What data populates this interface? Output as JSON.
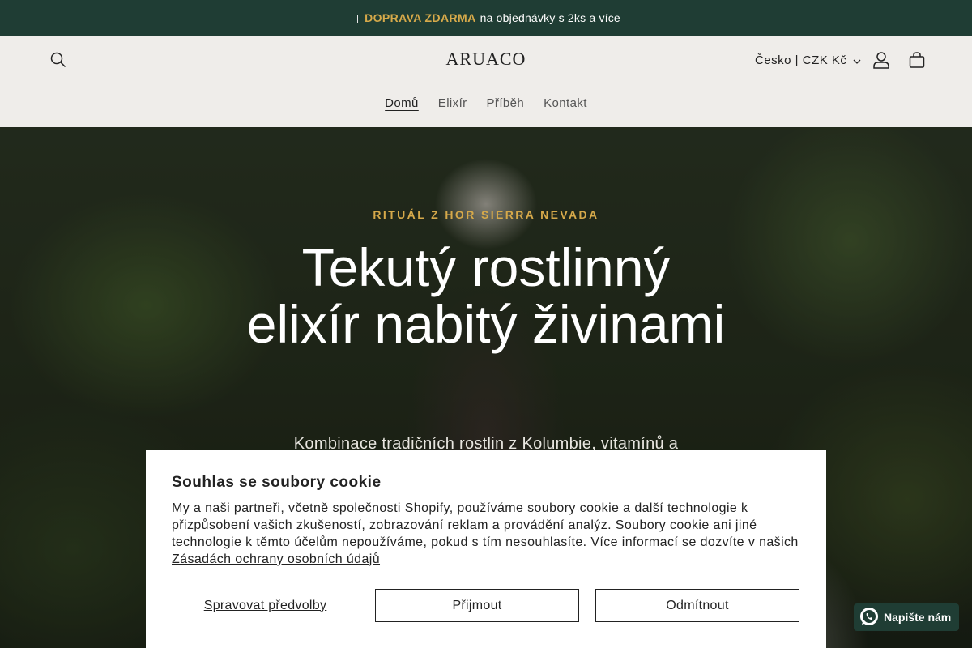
{
  "announcement": {
    "highlight": "DOPRAVA ZDARMA",
    "text": "na objednávky s 2ks a více",
    "highlight_color": "#d6a94a",
    "background": "#1f3d34"
  },
  "header": {
    "logo": "ARUACO",
    "locale": "Česko | CZK Kč",
    "icons": [
      "search-icon",
      "account-icon",
      "cart-icon",
      "chevron-down-icon"
    ],
    "nav": [
      {
        "label": "Domů",
        "active": true
      },
      {
        "label": "Elixír",
        "active": false
      },
      {
        "label": "Příběh",
        "active": false
      },
      {
        "label": "Kontakt",
        "active": false
      }
    ]
  },
  "hero": {
    "eyebrow": "RITUÁL Z HOR SIERRA NEVADA",
    "title": "Tekutý rostlinný elixír nabitý živinami",
    "subtitle": "Kombinace tradičních rostlin z Kolumbie, vitamínů a"
  },
  "cookie": {
    "title": "Souhlas se soubory cookie",
    "body": "My a naši partneři, včetně společnosti Shopify, používáme soubory cookie a další technologie k přizpůsobení vašich zkušeností, zobrazování reklam a provádění analýz. Soubory cookie ani jiné technologie k těmto účelům nepoužíváme, pokud s tím nesouhlasíte. Více informací se dozvíte v našich",
    "link": "Zásadách ochrany osobních údajů",
    "manage": "Spravovat předvolby",
    "accept": "Přijmout",
    "decline": "Odmítnout"
  },
  "whatsapp": {
    "label": "Napište nám",
    "icon": "whatsapp-icon"
  }
}
